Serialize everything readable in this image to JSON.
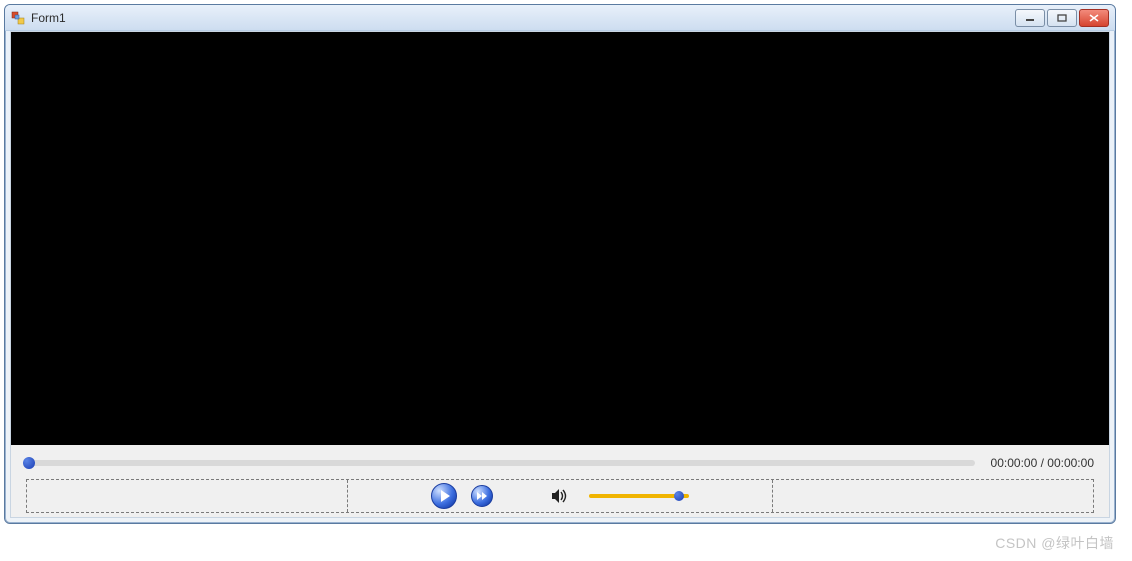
{
  "window": {
    "title": "Form1"
  },
  "player": {
    "current_time": "00:00:00",
    "total_time": "00:00:00",
    "time_separator": " / "
  },
  "watermark": "CSDN @绿叶白墙"
}
